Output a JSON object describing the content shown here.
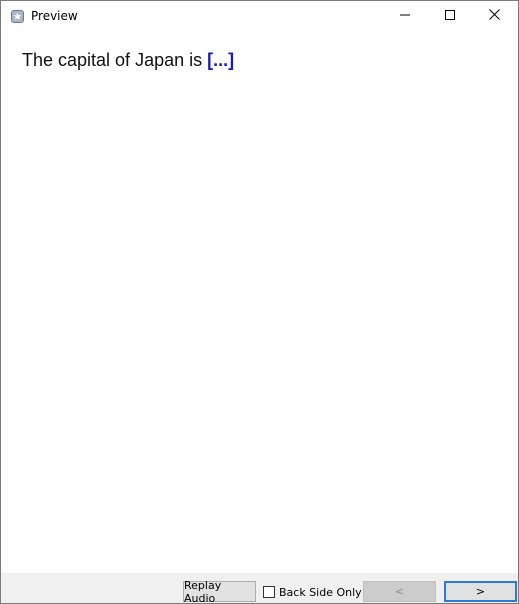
{
  "window": {
    "title": "Preview",
    "icon": "anki-app-icon",
    "controls": {
      "minimize": "minimize-icon",
      "maximize": "maximize-icon",
      "close": "close-icon"
    }
  },
  "card": {
    "text_prefix": "The capital of Japan is ",
    "cloze": "[...]",
    "cloze_color": "#1a1ab8"
  },
  "footer": {
    "replay_label": "Replay Audio",
    "back_side_only_label": "Back Side Only",
    "back_side_only_checked": false,
    "prev_label": "<",
    "next_label": ">"
  }
}
